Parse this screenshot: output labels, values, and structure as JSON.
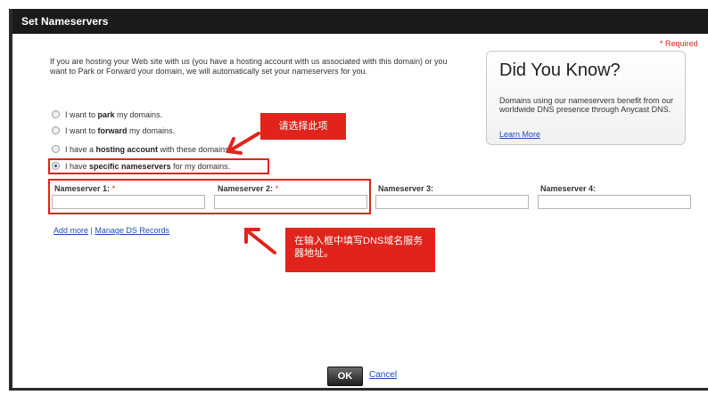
{
  "dialog": {
    "title": "Set Nameservers",
    "required_note": "* Required"
  },
  "intro": "If you are hosting your Web site with us (you have a hosting account with us associated with this domain) or you want to Park or Forward your domain, we will automatically set your nameservers for you.",
  "did_you_know": {
    "title": "Did You Know?",
    "text": "Domains using our nameservers benefit from our worldwide DNS presence through Anycast DNS.",
    "link": "Learn More"
  },
  "options": [
    {
      "pre": "I want to ",
      "bold": "park",
      "post": " my domains.",
      "selected": false
    },
    {
      "pre": "I want to ",
      "bold": "forward",
      "post": " my domains.",
      "selected": false
    },
    {
      "pre": "I have a ",
      "bold": "hosting account",
      "post": " with these domains.",
      "selected": false
    },
    {
      "pre": "I have ",
      "bold": "specific nameservers",
      "post": " for my domains.",
      "selected": true
    }
  ],
  "nameservers": [
    {
      "label": "Nameserver 1:",
      "required": "*",
      "value": ""
    },
    {
      "label": "Nameserver 2:",
      "required": "*",
      "value": ""
    },
    {
      "label": "Nameserver 3:",
      "required": "",
      "value": ""
    },
    {
      "label": "Nameserver 4:",
      "required": "",
      "value": ""
    }
  ],
  "links": {
    "add_more": "Add more",
    "separator": "|",
    "manage_ds": "Manage DS Records"
  },
  "annotations": {
    "select_option": "请选择此项",
    "fill_dns": "在输入框中填写DNS域名服务器地址。"
  },
  "buttons": {
    "ok": "OK",
    "cancel": "Cancel"
  },
  "colors": {
    "annotation_red": "#e0231b",
    "link_blue": "#1a4db3",
    "title_bar": "#1b1b1b"
  }
}
